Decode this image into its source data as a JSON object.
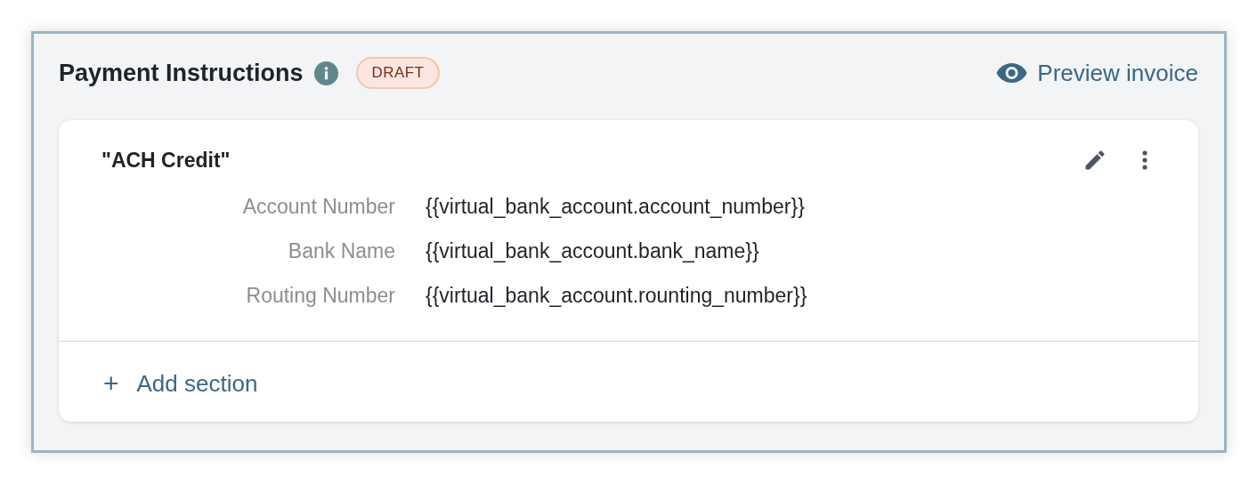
{
  "header": {
    "title": "Payment Instructions",
    "badge": "DRAFT",
    "preview_link": "Preview invoice"
  },
  "card": {
    "title": "\"ACH Credit\"",
    "fields": [
      {
        "label": "Account Number",
        "value": "{{virtual_bank_account.account_number}}"
      },
      {
        "label": "Bank Name",
        "value": "{{virtual_bank_account.bank_name}}"
      },
      {
        "label": "Routing Number",
        "value": "{{virtual_bank_account.rounting_number}}"
      }
    ],
    "add_button": {
      "icon": "+",
      "label": "Add section"
    }
  }
}
